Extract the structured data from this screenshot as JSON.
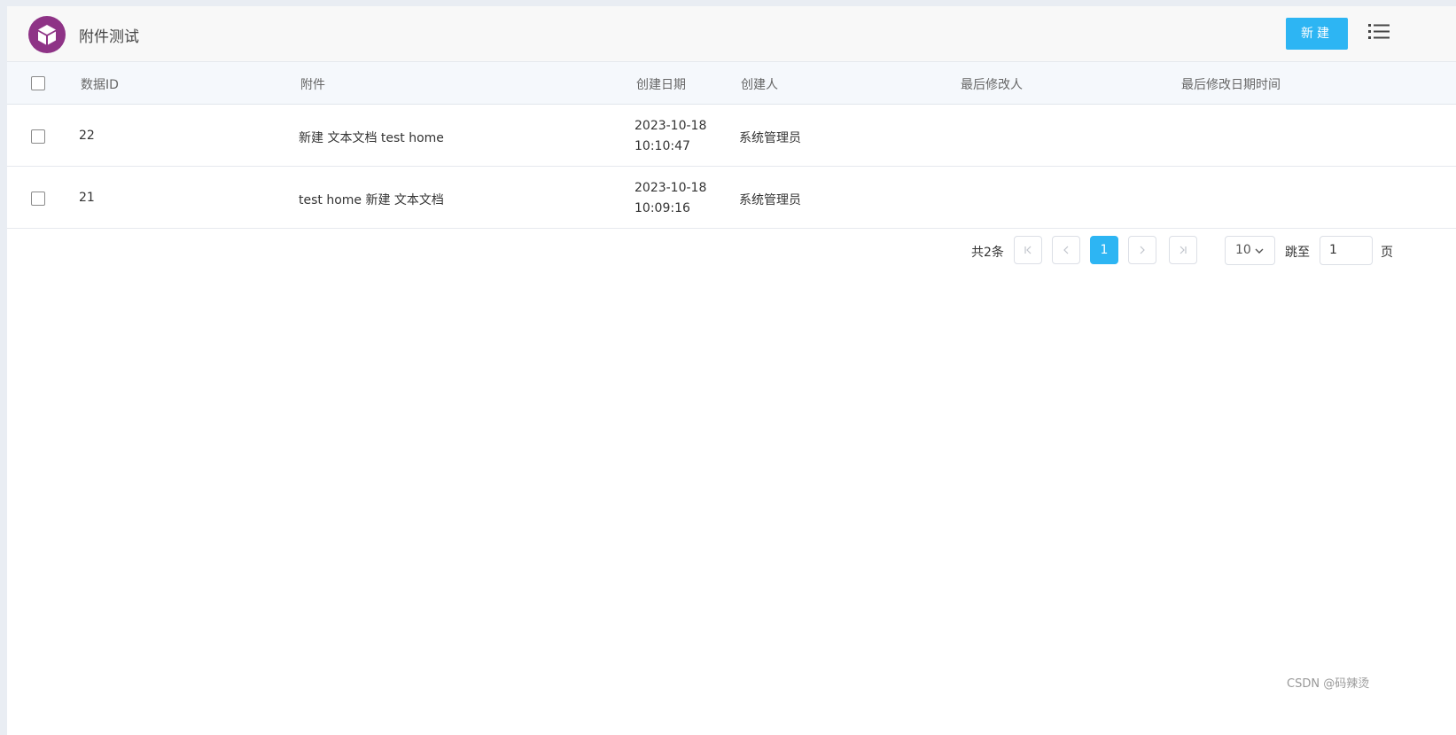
{
  "header": {
    "title": "附件测试",
    "new_button": "新建",
    "logo_icon": "box-icon",
    "menu_icon": "list-menu-icon",
    "accent_color": "#2db5f3",
    "logo_color": "#8e3386"
  },
  "table": {
    "columns": [
      "数据ID",
      "附件",
      "创建日期",
      "创建人",
      "最后修改人",
      "最后修改日期时间"
    ],
    "rows": [
      {
        "id": "22",
        "attachment": "新建 文本文档 test home",
        "date": "2023-10-18",
        "time": "10:10:47",
        "creator": "系统管理员",
        "modifier": "",
        "modified_at": ""
      },
      {
        "id": "21",
        "attachment": "test home 新建 文本文档",
        "date": "2023-10-18",
        "time": "10:09:16",
        "creator": "系统管理员",
        "modifier": "",
        "modified_at": ""
      }
    ]
  },
  "pagination": {
    "total": "共2条",
    "current_page": "1",
    "page_size": "10",
    "goto_label": "跳至",
    "goto_value": "1",
    "page_label": "页"
  },
  "watermark": "CSDN @码辣烫"
}
